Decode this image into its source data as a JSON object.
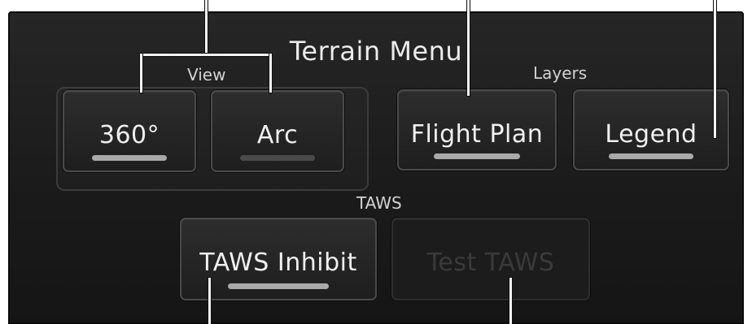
{
  "menu": {
    "title": "Terrain Menu",
    "groups": {
      "view": "View",
      "layers": "Layers",
      "taws": "TAWS"
    },
    "buttons": {
      "view_360": {
        "label": "360°",
        "indicator": "on"
      },
      "view_arc": {
        "label": "Arc",
        "indicator": "off"
      },
      "flight_plan": {
        "label": "Flight Plan",
        "indicator": "on"
      },
      "legend": {
        "label": "Legend",
        "indicator": "on"
      },
      "taws_inhibit": {
        "label": "TAWS Inhibit",
        "indicator": "on"
      },
      "test_taws": {
        "label": "Test TAWS",
        "enabled": false
      }
    }
  },
  "colors": {
    "panel": "#1c1c1c",
    "indicator_on": "#a9a9a9",
    "indicator_off": "#4a4a4a",
    "disabled_text": "#3a3a3a"
  }
}
